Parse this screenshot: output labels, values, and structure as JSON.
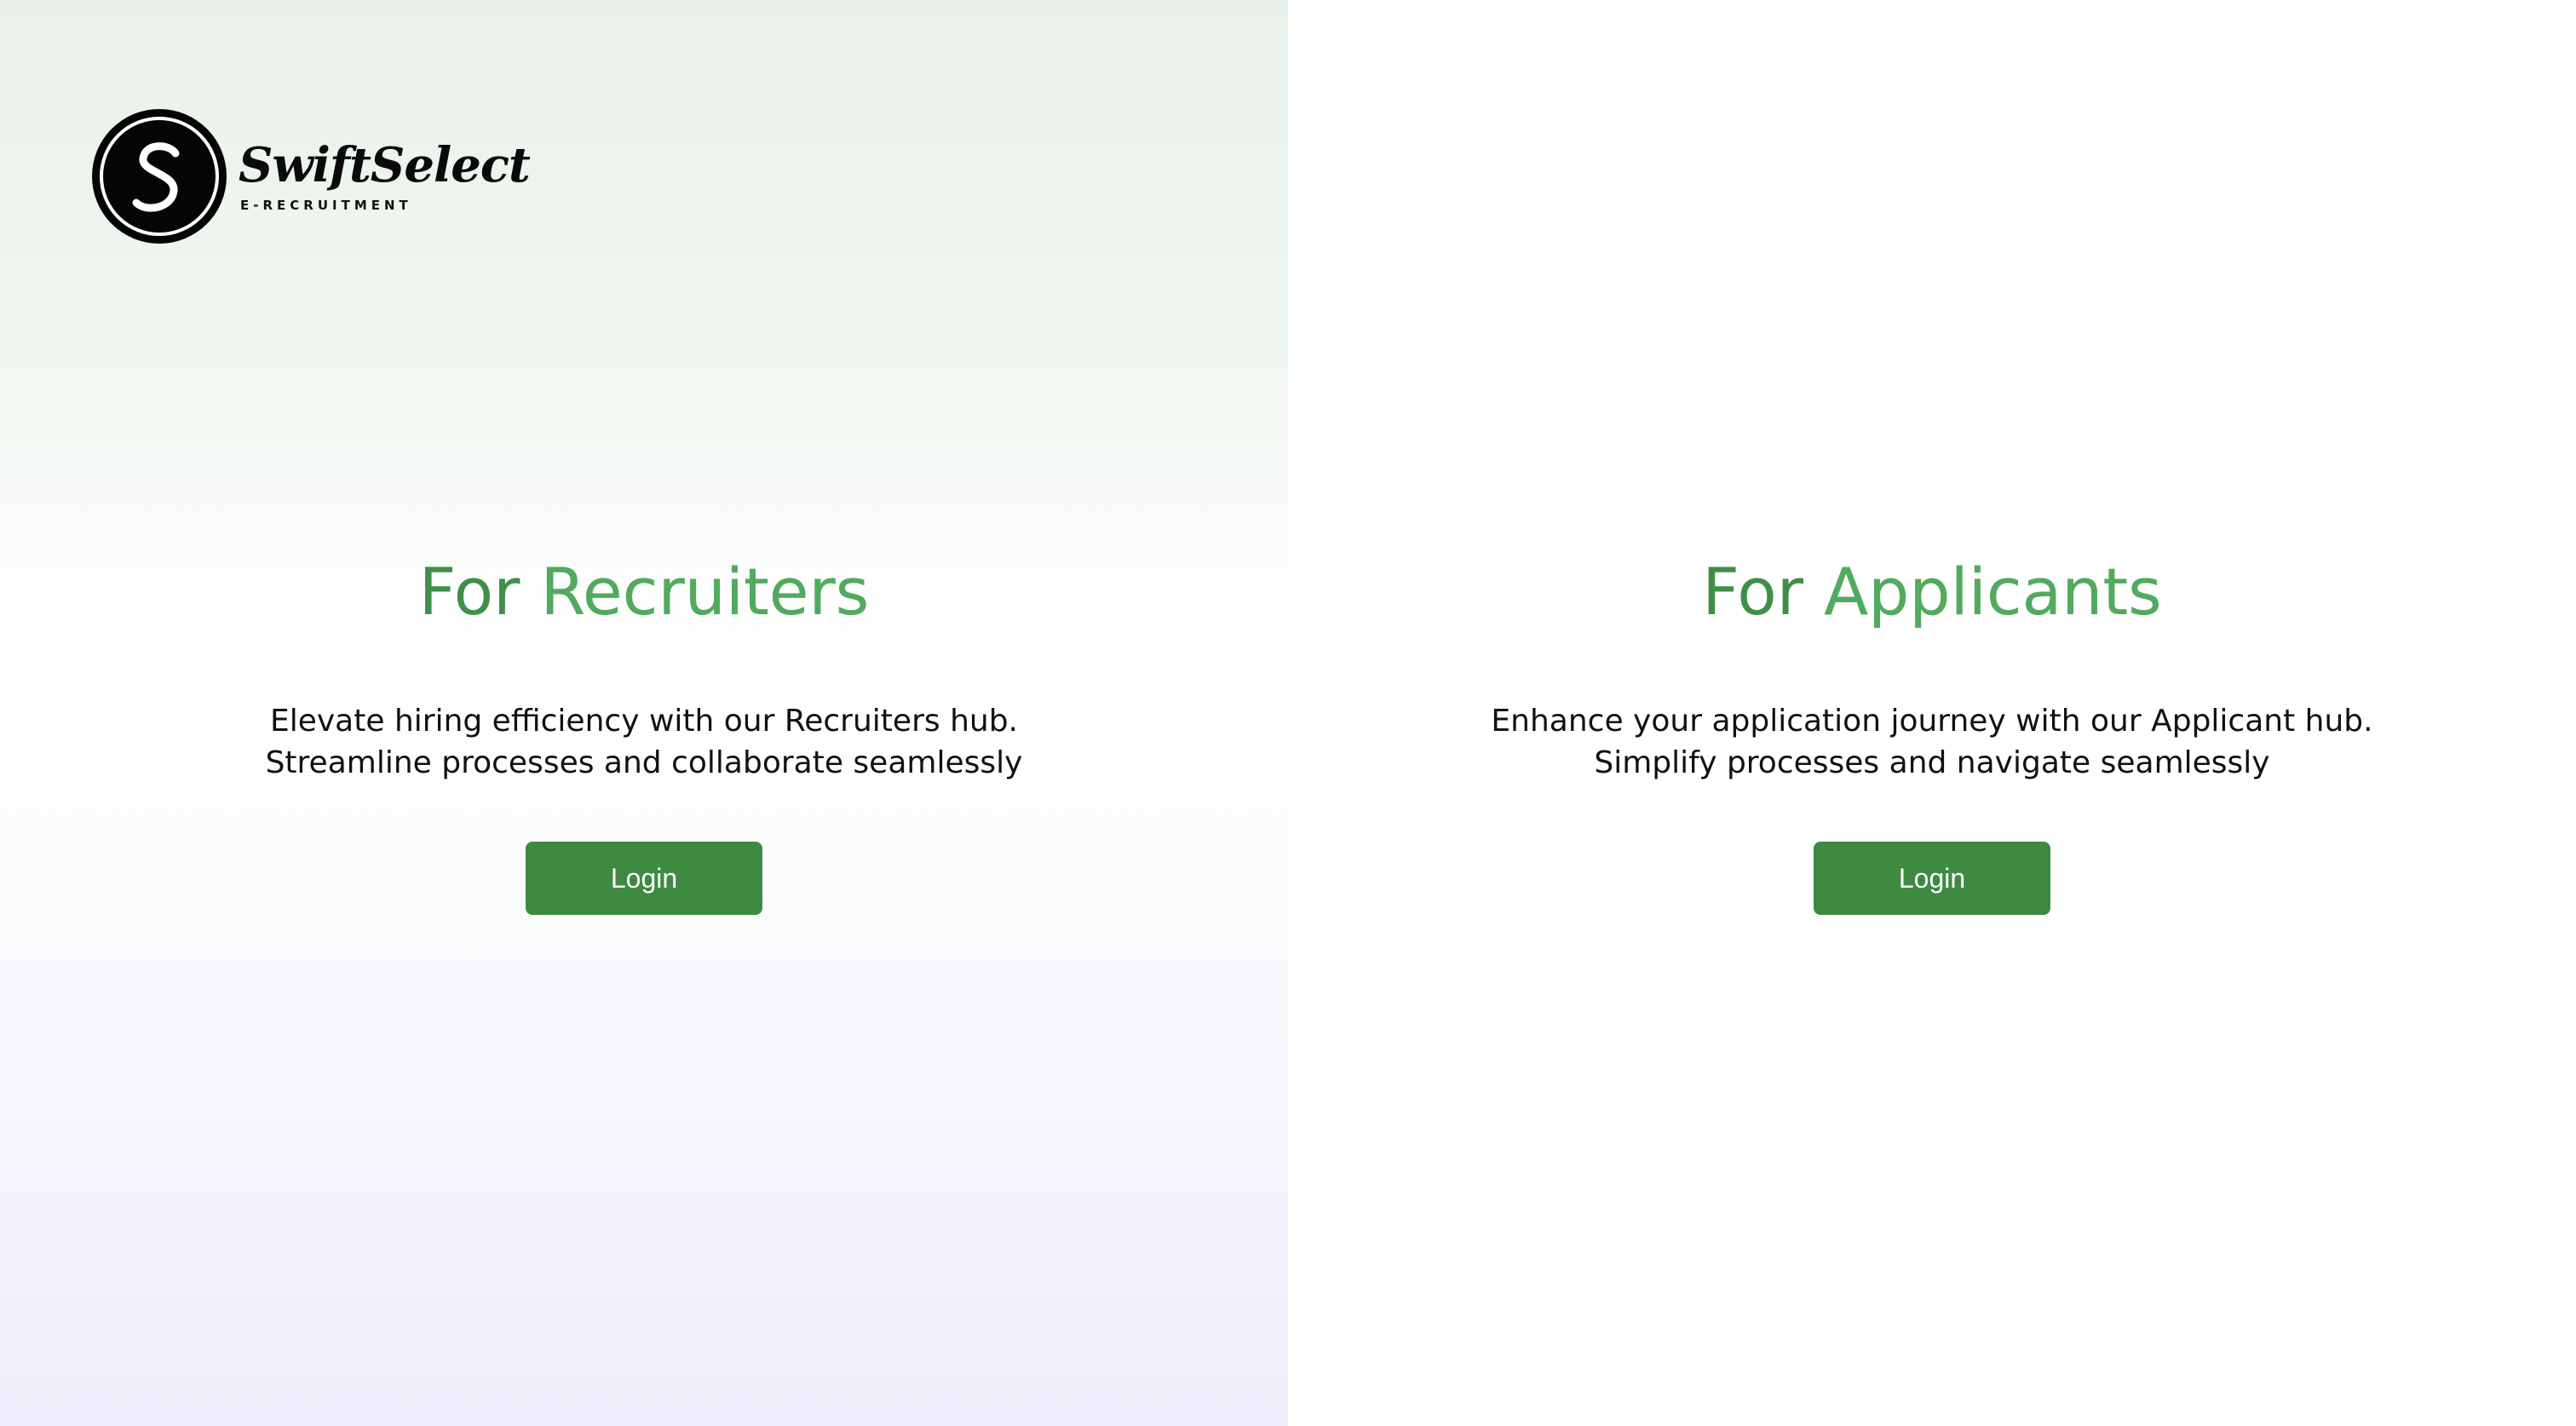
{
  "logo": {
    "name": "SwiftSelect",
    "subtitle": "E-RECRUITMENT",
    "monogram": "S"
  },
  "recruiters": {
    "heading_prefix": "For",
    "heading_role": "Recruiters",
    "description_line1": "Elevate hiring efficiency with our Recruiters hub.",
    "description_line2": "Streamline processes and collaborate seamlessly",
    "login_label": "Login"
  },
  "applicants": {
    "heading_prefix": "For",
    "heading_role": "Applicants",
    "description_line1": "Enhance your application journey with our Applicant hub.",
    "description_line2": "Simplify processes and navigate seamlessly",
    "login_label": "Login"
  },
  "colors": {
    "accent_green": "#3d8a40",
    "heading_green_dark": "#3f8f48",
    "heading_green_light": "#5fbf6e",
    "logo_black": "#050505"
  }
}
